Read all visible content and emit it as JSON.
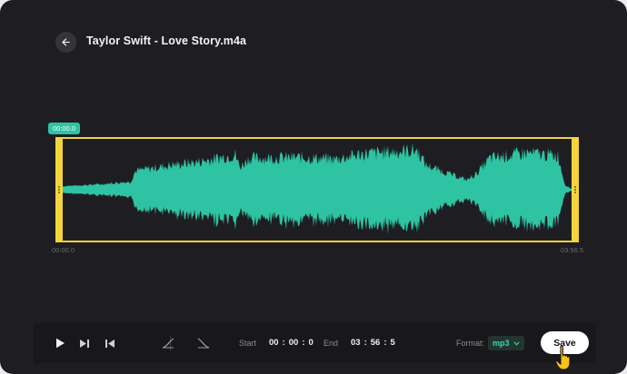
{
  "file": {
    "title": "Taylor Swift - Love Story.m4a"
  },
  "playhead": {
    "label": "00:00.0"
  },
  "timeline": {
    "start_label": "00:00.0",
    "end_label": "03:56.5"
  },
  "toolbar": {
    "start_label": "Start",
    "start_time": {
      "hh": "00",
      "mm": "00",
      "s": "0"
    },
    "end_label": "End",
    "end_time": {
      "hh": "03",
      "mm": "56",
      "s": "5"
    },
    "format_label": "Format:",
    "format_value": "mp3",
    "save_label": "Save"
  },
  "colors": {
    "accent": "#2ec4a3",
    "selection": "#f4d43c",
    "background": "#1e1e22"
  },
  "icons": [
    "back-arrow-icon",
    "play-icon",
    "skip-forward-icon",
    "skip-back-icon",
    "fade-in-icon",
    "fade-out-icon",
    "chevron-down-icon",
    "pointer-hand-icon"
  ]
}
